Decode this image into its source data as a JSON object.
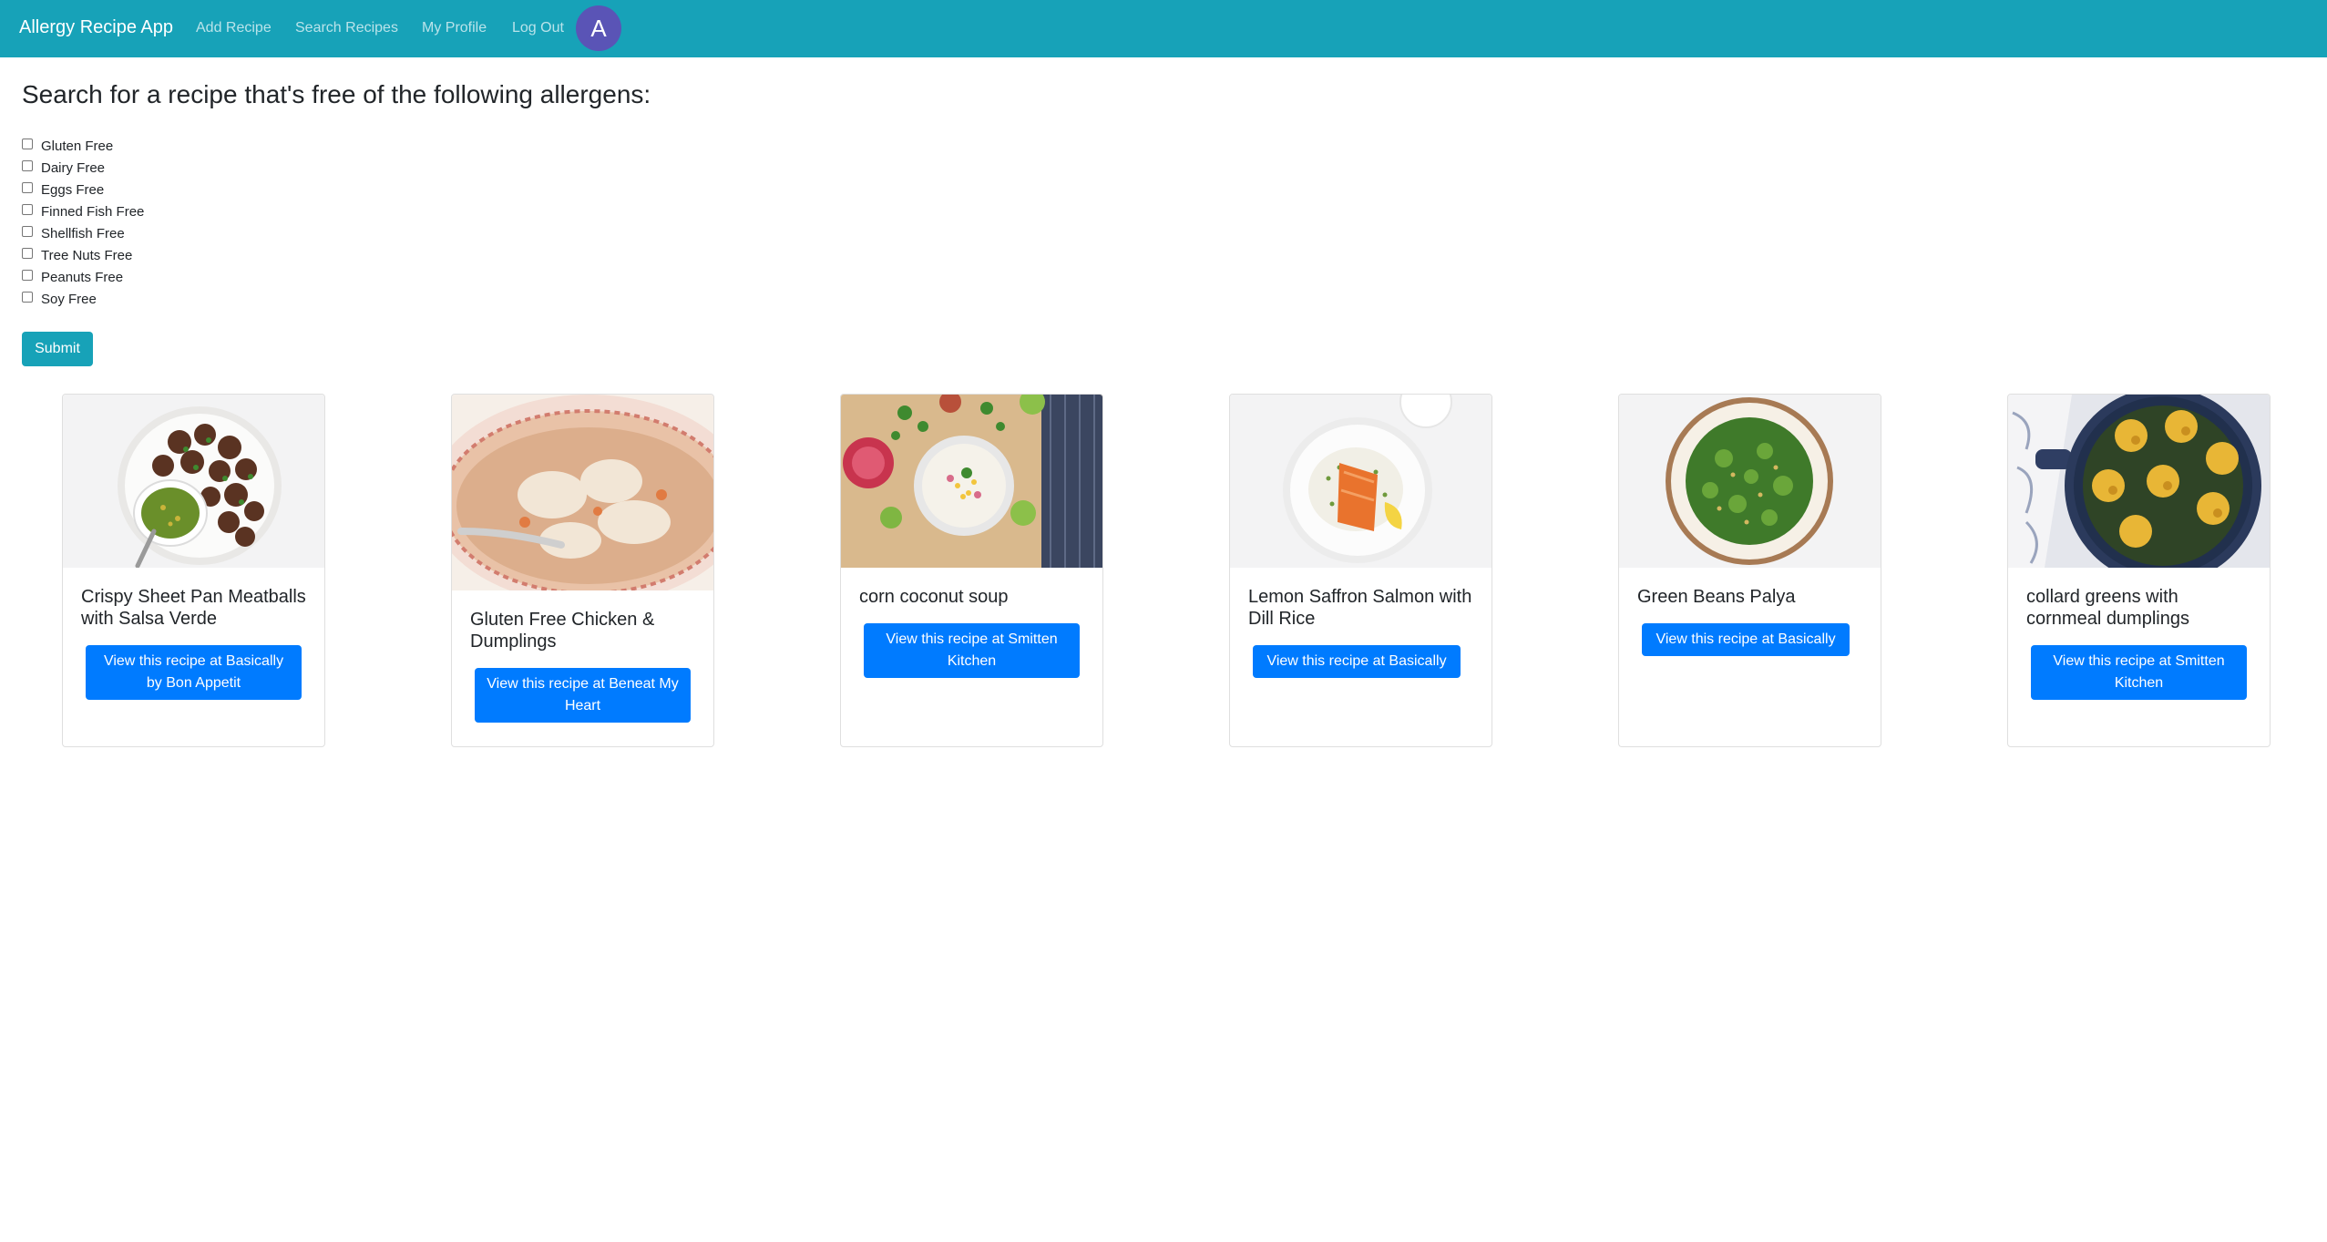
{
  "navbar": {
    "brand": "Allergy Recipe App",
    "links": [
      "Add Recipe",
      "Search Recipes",
      "My Profile",
      "Log Out"
    ],
    "avatar_letter": "A"
  },
  "search": {
    "heading": "Search for a recipe that's free of the following allergens:",
    "allergens": [
      {
        "label": "Gluten Free",
        "checked": false
      },
      {
        "label": "Dairy Free",
        "checked": false
      },
      {
        "label": "Eggs Free",
        "checked": false
      },
      {
        "label": "Finned Fish Free",
        "checked": false
      },
      {
        "label": "Shellfish Free",
        "checked": false
      },
      {
        "label": "Tree Nuts Free",
        "checked": false
      },
      {
        "label": "Peanuts Free",
        "checked": false
      },
      {
        "label": "Soy Free",
        "checked": false
      }
    ],
    "submit_label": "Submit"
  },
  "recipes": [
    {
      "title": "Crispy Sheet Pan Meatballs with Salsa Verde",
      "button": "View this recipe at Basically by Bon Appetit"
    },
    {
      "title": "Gluten Free Chicken & Dumplings",
      "button": "View this recipe at Beneat My Heart"
    },
    {
      "title": "corn coconut soup",
      "button": "View this recipe at Smitten Kitchen"
    },
    {
      "title": "Lemon Saffron Salmon with Dill Rice",
      "button": "View this recipe at Basically"
    },
    {
      "title": "Green Beans Palya",
      "button": "View this recipe at Basically"
    },
    {
      "title": "collard greens with cornmeal dumplings",
      "button": "View this recipe at Smitten Kitchen"
    }
  ],
  "colors": {
    "navbar": "#17a2b8",
    "avatar": "#5a54b6",
    "primary_button": "#007bff",
    "submit_button": "#17a2b8"
  }
}
